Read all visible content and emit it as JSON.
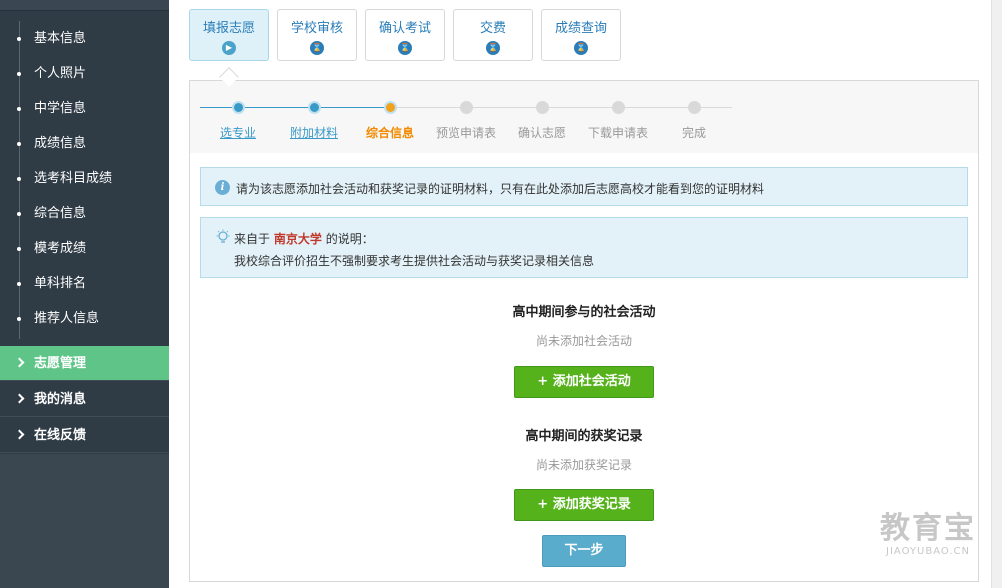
{
  "sidebar": {
    "sub_items": [
      "基本信息",
      "个人照片",
      "中学信息",
      "成绩信息",
      "选考科目成绩",
      "综合信息",
      "模考成绩",
      "单科排名",
      "推荐人信息"
    ],
    "nav_items": [
      {
        "label": "志愿管理",
        "active": true
      },
      {
        "label": "我的消息",
        "active": false
      },
      {
        "label": "在线反馈",
        "active": false
      }
    ]
  },
  "tabs": [
    {
      "label": "填报志愿",
      "active": true,
      "icon": "play-icon"
    },
    {
      "label": "学校审核",
      "active": false,
      "icon": "hourglass-icon"
    },
    {
      "label": "确认考试",
      "active": false,
      "icon": "hourglass-icon"
    },
    {
      "label": "交费",
      "active": false,
      "icon": "hourglass-icon"
    },
    {
      "label": "成绩查询",
      "active": false,
      "icon": "hourglass-icon"
    }
  ],
  "steps": [
    {
      "label": "选专业",
      "state": "done"
    },
    {
      "label": "附加材料",
      "state": "done"
    },
    {
      "label": "综合信息",
      "state": "current"
    },
    {
      "label": "预览申请表",
      "state": "todo"
    },
    {
      "label": "确认志愿",
      "state": "todo"
    },
    {
      "label": "下载申请表",
      "state": "todo"
    },
    {
      "label": "完成",
      "state": "todo"
    }
  ],
  "info": {
    "text": "请为该志愿添加社会活动和获奖记录的证明材料，只有在此处添加后志愿高校才能看到您的证明材料"
  },
  "note": {
    "prefix": "来自于",
    "school": "南京大学",
    "suffix": "的说明：",
    "text": "我校综合评价招生不强制要求考生提供社会活动与获奖记录相关信息"
  },
  "social": {
    "title": "高中期间参与的社会活动",
    "empty": "尚未添加社会活动",
    "button": "+ 添加社会活动"
  },
  "awards": {
    "title": "高中期间的获奖记录",
    "empty": "尚未添加获奖记录",
    "button": "+ 添加获奖记录"
  },
  "next_button": "下一步",
  "watermark": {
    "main": "教育宝",
    "sub": "JIAOYUBAO.CN"
  },
  "colors": {
    "accent": "#2a7db8",
    "active_nav": "#5fc488",
    "add_button": "#55b21b",
    "current_step": "#f28a00"
  }
}
